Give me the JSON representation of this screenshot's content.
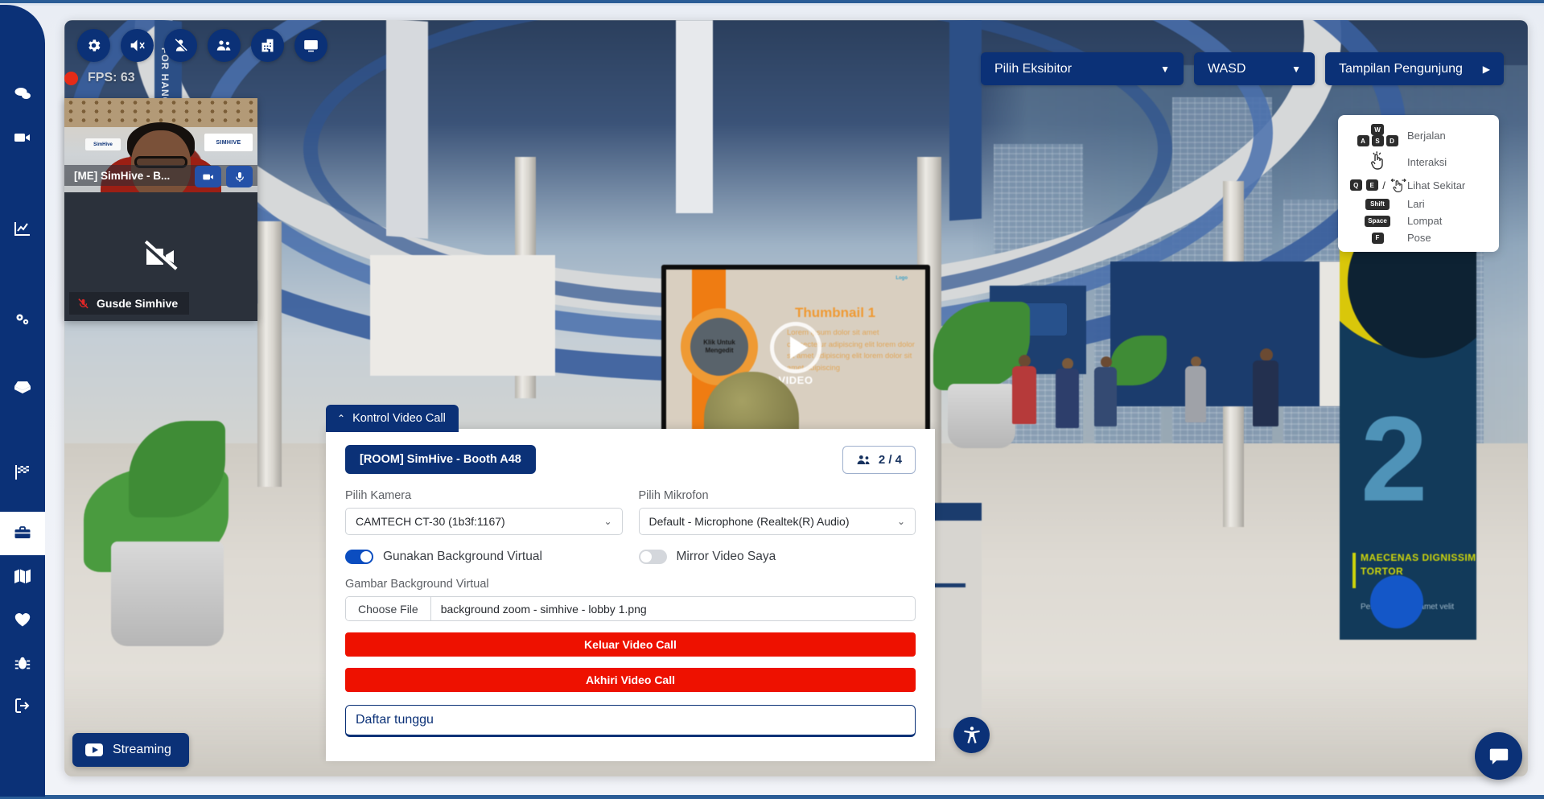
{
  "app": {
    "brand_navy": "#0b3177",
    "danger_red": "#ee1100"
  },
  "sidebar": {
    "items": [
      {
        "name": "chat",
        "icon": "chat-bubbles-icon"
      },
      {
        "name": "video",
        "icon": "video-camera-icon"
      },
      {
        "name": "analytics",
        "icon": "line-chart-icon"
      },
      {
        "name": "settings",
        "icon": "gears-icon"
      },
      {
        "name": "inbox",
        "icon": "open-box-icon"
      },
      {
        "name": "checkered-flag",
        "icon": "checkered-flag-icon"
      },
      {
        "name": "booth",
        "icon": "briefcase-icon",
        "active": true
      },
      {
        "name": "map",
        "icon": "map-icon"
      },
      {
        "name": "favorites",
        "icon": "heart-icon"
      },
      {
        "name": "bug",
        "icon": "bug-icon"
      },
      {
        "name": "logout",
        "icon": "logout-icon"
      }
    ]
  },
  "toolbar": {
    "buttons": [
      {
        "name": "settings",
        "icon": "gear-icon"
      },
      {
        "name": "mute-audio",
        "icon": "speaker-muted-icon"
      },
      {
        "name": "disable-avatar",
        "icon": "person-slash-icon"
      },
      {
        "name": "participants",
        "icon": "people-icon"
      },
      {
        "name": "buildings",
        "icon": "building-icon"
      },
      {
        "name": "presentation",
        "icon": "screen-icon"
      }
    ]
  },
  "status": {
    "recording": true,
    "fps_label": "FPS: 63"
  },
  "video_tiles": [
    {
      "name": "[ME] SimHive - B...",
      "self": true,
      "actions": [
        {
          "name": "toggle-camera",
          "icon": "video-camera-icon"
        },
        {
          "name": "toggle-mic",
          "icon": "microphone-icon"
        }
      ]
    },
    {
      "name": "Gusde Simhive",
      "self": false,
      "camera_off": true,
      "mic_muted": true
    }
  ],
  "top_right": {
    "exhibitor_select": {
      "label": "Pilih Eksibitor",
      "caret": "▼"
    },
    "wasd_select": {
      "label": "WASD",
      "caret": "▼"
    },
    "visitor_view": {
      "label": "Tampilan Pengunjung",
      "arrow": "▶"
    }
  },
  "keyboard_help": {
    "rows": [
      {
        "keys": [
          "W",
          "A",
          "S",
          "D"
        ],
        "layout": "wasd",
        "label": "Berjalan"
      },
      {
        "keys": [],
        "layout": "hand",
        "label": "Interaksi"
      },
      {
        "keys": [
          "Q",
          "E"
        ],
        "layout": "qe",
        "separator": "/",
        "label": "Lihat Sekitar"
      },
      {
        "keys": [
          "Shift"
        ],
        "layout": "single",
        "label": "Lari"
      },
      {
        "keys": [
          "Space"
        ],
        "layout": "single",
        "label": "Lompat"
      },
      {
        "keys": [
          "F"
        ],
        "layout": "single",
        "label": "Pose"
      }
    ]
  },
  "video_call_panel": {
    "tab_label": "Kontrol Video Call",
    "tab_chevron": "⌃",
    "room_label": "[ROOM] SimHive - Booth A48",
    "participants_count": "2 / 4",
    "camera": {
      "label": "Pilih Kamera",
      "value": "CAMTECH CT-30 (1b3f:1167)"
    },
    "microphone": {
      "label": "Pilih Mikrofon",
      "value": "Default - Microphone (Realtek(R) Audio)"
    },
    "virtual_background_toggle": {
      "label": "Gunakan Background Virtual",
      "on": true
    },
    "mirror_toggle": {
      "label": "Mirror Video Saya",
      "on": false
    },
    "background_image": {
      "label": "Gambar Background Virtual",
      "choose_button": "Choose File",
      "file_name": "background zoom - simhive - lobby 1.png"
    },
    "leave_button": "Keluar Video Call",
    "end_button": "Akhiri Video Call",
    "waitlist_button": "Daftar tunggu"
  },
  "streaming_button": {
    "label": "Streaming",
    "icon": "youtube-icon"
  },
  "floating": {
    "accessibility": {
      "name": "accessibility-icon"
    },
    "chat": {
      "name": "chat-bubble-icon"
    }
  },
  "scene": {
    "presentation_screen": {
      "title": "Thumbnail 1",
      "circle_text": "Klik Untuk Mengedit",
      "video_label": "VIDEO",
      "logo_text": "Logo",
      "body_lines": "Lorem ipsum dolor sit amet consectetur adipiscing elit lorem dolor sit amet adipiscing elit lorem dolor sit amet adipiscing"
    },
    "hanging_banner_text": "FOR HANGING",
    "right_banner": {
      "number": "2",
      "headline": "MAECENAS DIGNISSIM TORTOR",
      "paragraph": "Pellentesque sit amet velit"
    }
  }
}
